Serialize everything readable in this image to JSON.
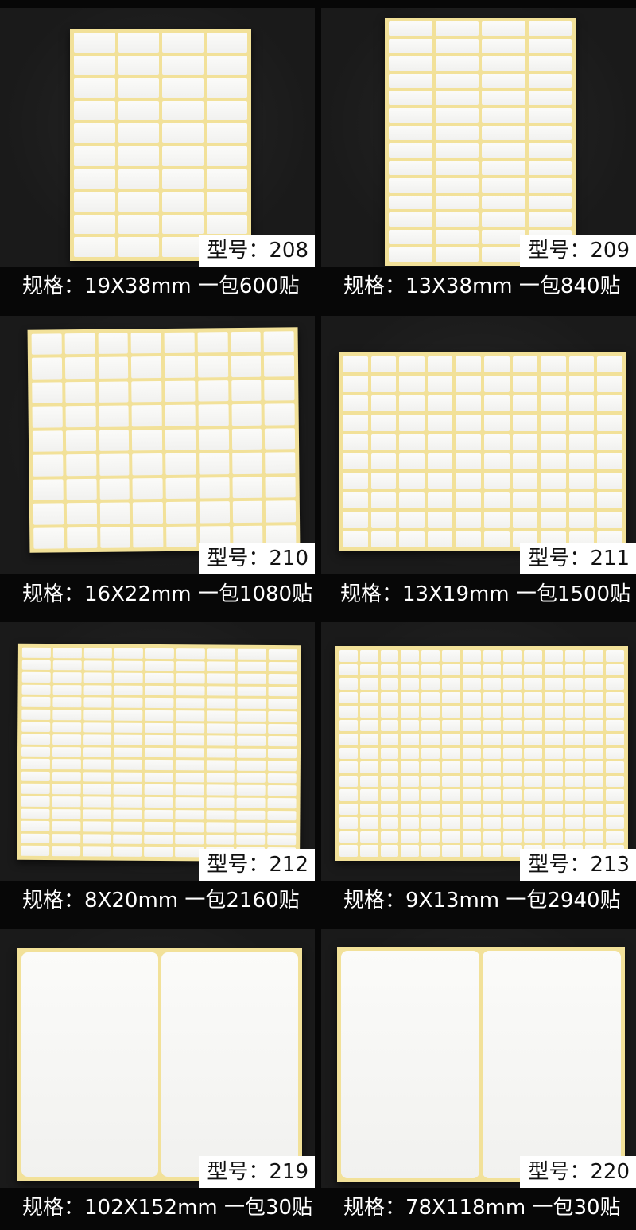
{
  "products": [
    {
      "model": "型号：208",
      "spec": "规格：19X38mm  一包600贴",
      "cols": 4,
      "rows": 10
    },
    {
      "model": "型号：209",
      "spec": "规格：13X38mm  一包840贴",
      "cols": 4,
      "rows": 14
    },
    {
      "model": "型号：210",
      "spec": "规格：16X22mm  一包1080贴",
      "cols": 8,
      "rows": 9
    },
    {
      "model": "型号：211",
      "spec": "规格：13X19mm  一包1500贴",
      "cols": 10,
      "rows": 10
    },
    {
      "model": "型号：212",
      "spec": "规格：8X20mm  一包2160贴",
      "cols": 9,
      "rows": 17
    },
    {
      "model": "型号：213",
      "spec": "规格：9X13mm  一包2940贴",
      "cols": 14,
      "rows": 15
    },
    {
      "model": "型号：219",
      "spec": "规格：102X152mm  一包30贴",
      "cols": 2,
      "rows": 1
    },
    {
      "model": "型号：220",
      "spec": "规格：78X118mm  一包30贴",
      "cols": 2,
      "rows": 1
    }
  ]
}
